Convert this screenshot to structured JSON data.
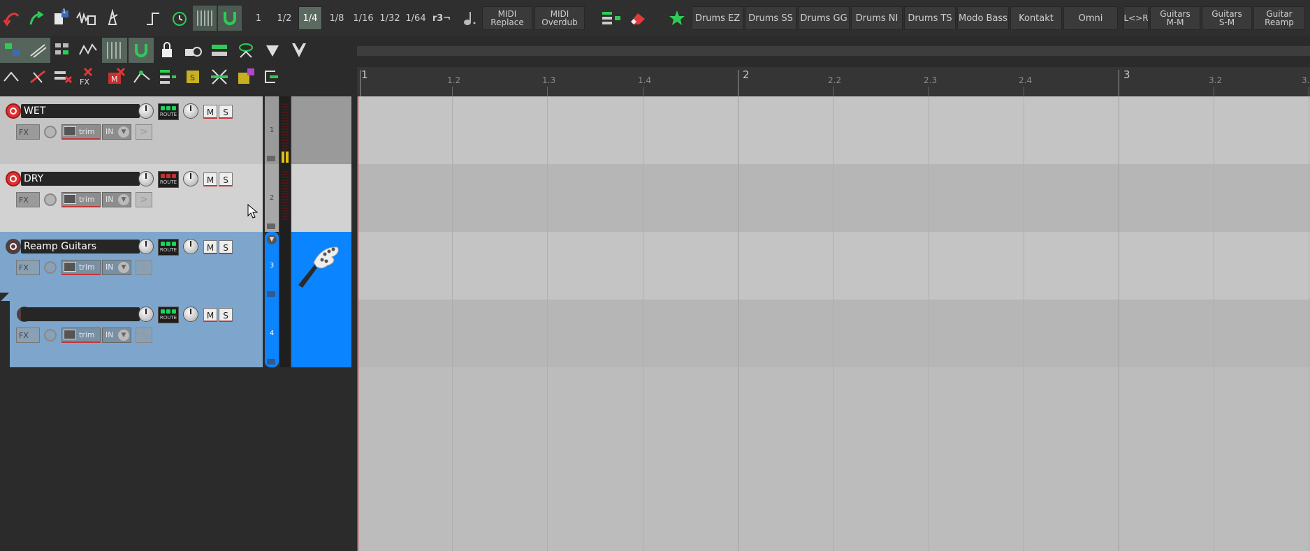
{
  "toolbar": {
    "grid_divisions": [
      "1",
      "1/2",
      "1/4",
      "1/8",
      "1/16",
      "1/32",
      "1/64"
    ],
    "triplet_label": "r3¬",
    "midi_buttons": [
      "MIDI\nReplace",
      "MIDI\nOverdub"
    ],
    "preset_buttons": [
      "Drums EZ",
      "Drums SS",
      "Drums GG",
      "Drums NI",
      "Drums TS",
      "Modo Bass",
      "Kontakt",
      "Omni"
    ],
    "routing_buttons": [
      "L<>R",
      "Guitars\nM-M",
      "Guitars\nS-M",
      "Guitar\nReamp"
    ],
    "badge_count": "1",
    "active_division": "1/4"
  },
  "ruler": {
    "marks": [
      "1",
      "1.2",
      "1.3",
      "1.4",
      "2",
      "2.2",
      "2.3",
      "2.4",
      "3",
      "3.2",
      "3."
    ]
  },
  "tracks": [
    {
      "name": "WET",
      "number": "1",
      "route_label": "ROUTE",
      "mute": "M",
      "solo": "S",
      "fx": "FX",
      "env": "trim",
      "input": "IN",
      "armed": true,
      "selected": false
    },
    {
      "name": "DRY",
      "number": "2",
      "route_label": "ROUTE",
      "mute": "M",
      "solo": "S",
      "fx": "FX",
      "env": "trim",
      "input": "IN",
      "armed": true,
      "selected": false
    },
    {
      "name": "Reamp Guitars",
      "number": "3",
      "route_label": "ROUTE",
      "mute": "M",
      "solo": "S",
      "fx": "FX",
      "env": "trim",
      "input": "IN",
      "armed": false,
      "selected": true
    },
    {
      "name": "",
      "number": "4",
      "route_label": "ROUTE",
      "mute": "M",
      "solo": "S",
      "fx": "FX",
      "env": "trim",
      "input": "IN",
      "armed": false,
      "selected": true
    }
  ],
  "colors": {
    "selected_track": "#0a84ff",
    "track_panel_light": "#c9c9c9",
    "track_panel_selected": "#7ea6cc",
    "arrange_bg": "#bcbcbc"
  }
}
